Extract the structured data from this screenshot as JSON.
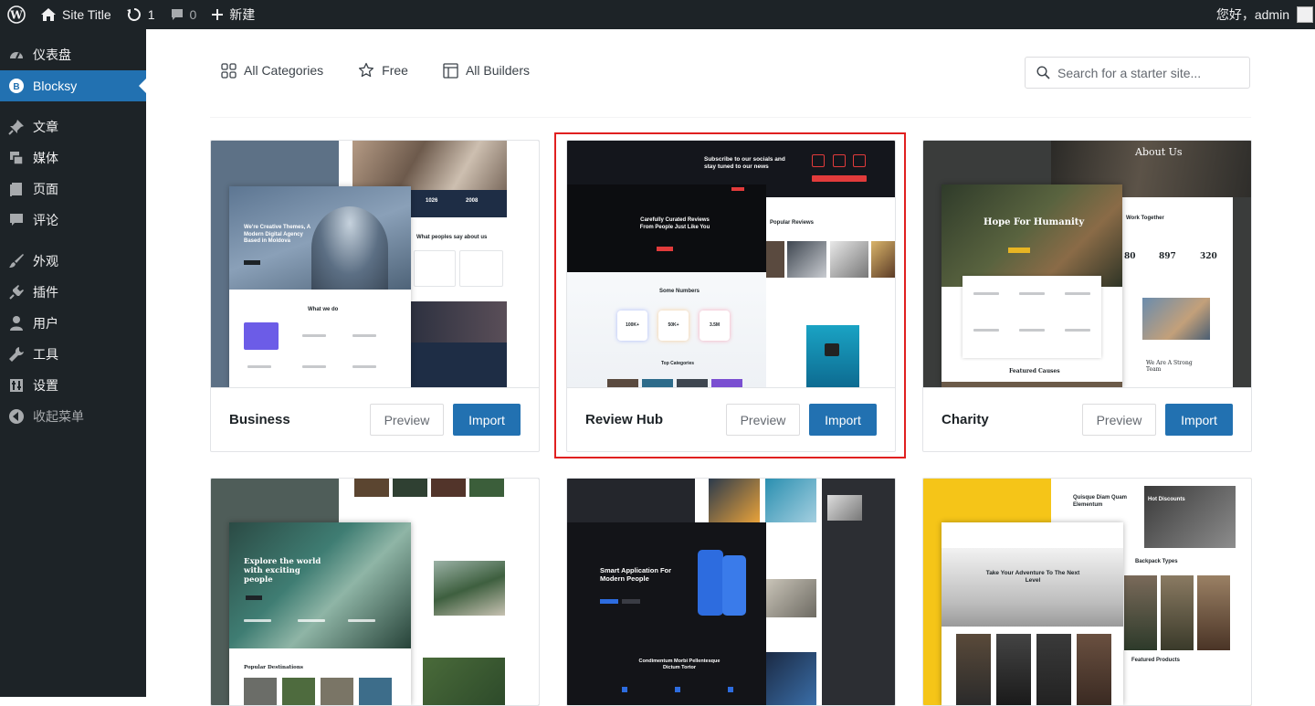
{
  "adminbar": {
    "site_title": "Site Title",
    "updates_count": "1",
    "comments_count": "0",
    "new_label": "新建",
    "greeting": "您好，admin"
  },
  "sidebar": {
    "items": [
      {
        "label": "仪表盘",
        "icon": "dashboard-icon"
      },
      {
        "label": "Blocksy",
        "icon": "blocksy-icon"
      },
      {
        "label": "文章",
        "icon": "pin-icon"
      },
      {
        "label": "媒体",
        "icon": "media-icon"
      },
      {
        "label": "页面",
        "icon": "page-icon"
      },
      {
        "label": "评论",
        "icon": "comment-icon"
      },
      {
        "label": "外观",
        "icon": "brush-icon"
      },
      {
        "label": "插件",
        "icon": "plugin-icon"
      },
      {
        "label": "用户",
        "icon": "user-icon"
      },
      {
        "label": "工具",
        "icon": "wrench-icon"
      },
      {
        "label": "设置",
        "icon": "settings-icon"
      },
      {
        "label": "收起菜单",
        "icon": "collapse-icon"
      }
    ]
  },
  "filters": {
    "all_categories": "All Categories",
    "free": "Free",
    "all_builders": "All Builders"
  },
  "search": {
    "placeholder": "Search for a starter site..."
  },
  "buttons": {
    "preview": "Preview",
    "import": "Import"
  },
  "cards": [
    {
      "name": "Business",
      "thumb": {
        "heading": "We're Creative Themes, A Modern Digital Agency Based in Moldova",
        "what_we_do": "What we do",
        "testimonials": "What peoples say about us",
        "stats": [
          "1026",
          "2008"
        ]
      }
    },
    {
      "name": "Review Hub",
      "thumb": {
        "socials": "Subscribe to our socials and stay tuned to our news",
        "hero": "Carefully Curated Reviews From People Just Like You",
        "numbers": "Some Numbers",
        "categories": "Top Categories",
        "popular": "Popular Reviews",
        "stats": [
          "100K+",
          "50K+",
          "3.5M"
        ]
      }
    },
    {
      "name": "Charity",
      "thumb": {
        "about": "About Us",
        "hero": "Hope For Humanity",
        "work": "Work Together",
        "featured": "Featured Causes",
        "team": "We Are A Strong Team",
        "stats": [
          "80",
          "897",
          "320"
        ]
      }
    },
    {
      "thumb": {
        "hero": "Explore the world with exciting people",
        "popular": "Popular Destinations"
      }
    },
    {
      "thumb": {
        "hero": "Smart Application For Modern People",
        "sub": "Condimentum Morbi Pellentesque Dictum Tortor"
      }
    },
    {
      "thumb": {
        "hero": "Take Your Adventure To The Next Level",
        "quote": "Quisque Diam Quam Elementum",
        "hot": "Hot Discounts",
        "backpacks": "Backpack Types",
        "featured": "Featured Products"
      }
    }
  ],
  "colors": {
    "admin_dark": "#1d2327",
    "wp_blue": "#2271b1",
    "highlight_red": "#e02020"
  }
}
